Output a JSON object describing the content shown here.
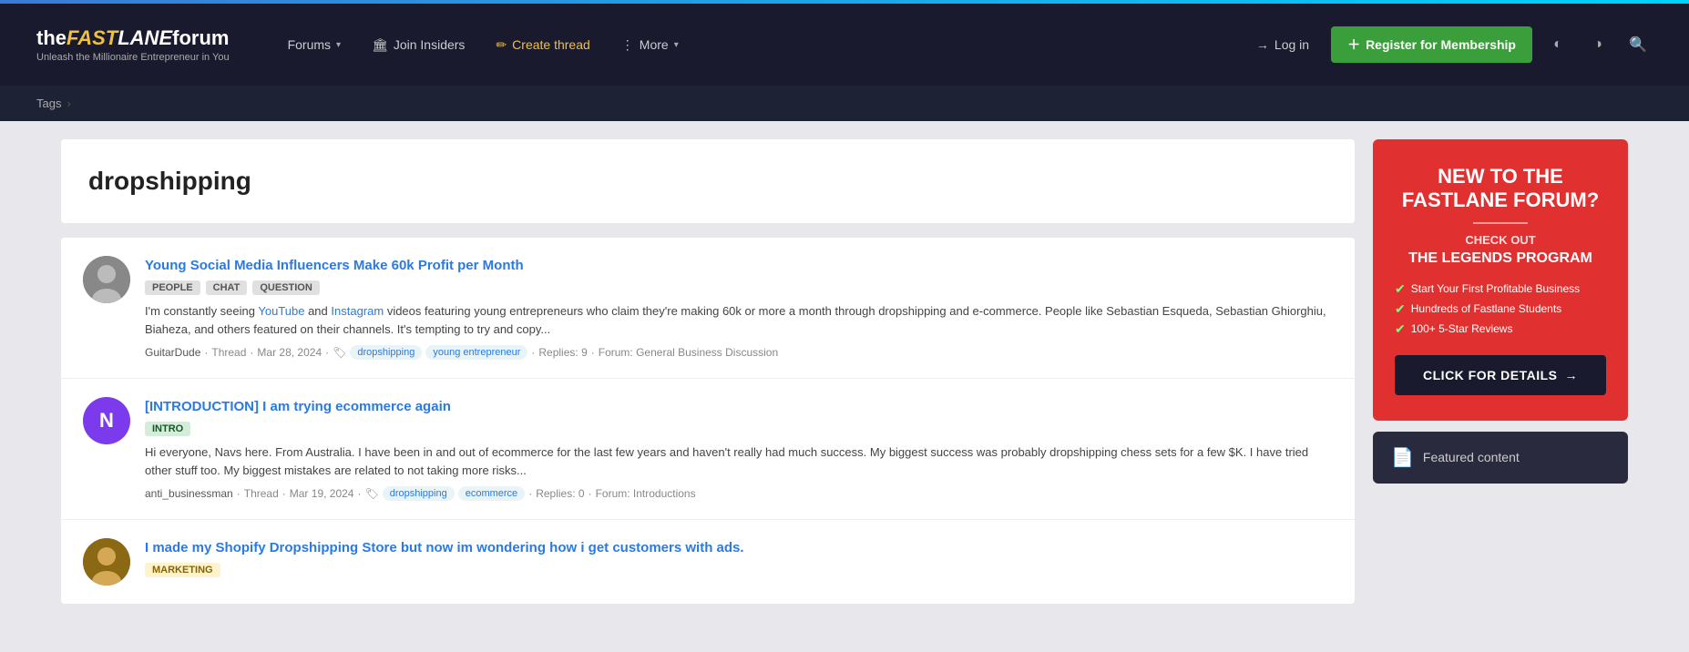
{
  "topbar": {},
  "header": {
    "logo": {
      "the": "the",
      "fast": "FAST",
      "lane": "LANE",
      "forum": "forum",
      "tagline": "Unleash the Millionaire Entrepreneur in You"
    },
    "nav": {
      "forums_label": "Forums",
      "join_insiders_label": "Join Insiders",
      "create_thread_label": "Create thread",
      "more_label": "More"
    },
    "login_label": "Log in",
    "register_label": "Register for Membership"
  },
  "breadcrumb": {
    "tags_label": "Tags"
  },
  "page": {
    "title": "dropshipping"
  },
  "threads": [
    {
      "id": 1,
      "avatar_letter": "",
      "avatar_type": "image",
      "avatar_color": "gray",
      "title": "Young Social Media Influencers Make 60k Profit per Month",
      "tags": [
        "PEOPLE",
        "CHAT",
        "QUESTION"
      ],
      "tag_types": [
        "default",
        "default",
        "default"
      ],
      "excerpt": "I'm constantly seeing YouTube and Instagram videos featuring young entrepreneurs who claim they're making 60k or more a month through dropshipping and e-commerce. People like Sebastian Esqueda, Sebastian Ghiorghiu, Biaheza, and others featured on their channels. It's tempting to try and copy...",
      "author": "GuitarDude",
      "type": "Thread",
      "date": "Mar 28, 2024",
      "tag_links": [
        "dropshipping",
        "young entrepreneur"
      ],
      "replies": "Replies: 9",
      "forum": "Forum: General Business Discussion"
    },
    {
      "id": 2,
      "avatar_letter": "N",
      "avatar_type": "letter",
      "avatar_color": "purple",
      "title": "[INTRODUCTION] I am trying ecommerce again",
      "tags": [
        "INTRO"
      ],
      "tag_types": [
        "intro"
      ],
      "excerpt": "Hi everyone, Navs here. From Australia. I have been in and out of ecommerce for the last few years and haven't really had much success. My biggest success was probably dropshipping chess sets for a few $K. I have tried other stuff too. My biggest mistakes are related to not taking more risks...",
      "author": "anti_businessman",
      "type": "Thread",
      "date": "Mar 19, 2024",
      "tag_links": [
        "dropshipping",
        "ecommerce"
      ],
      "replies": "Replies: 0",
      "forum": "Forum: Introductions"
    },
    {
      "id": 3,
      "avatar_letter": "",
      "avatar_type": "image2",
      "avatar_color": "brown",
      "title": "I made my Shopify Dropshipping Store but now im wondering how i get customers with ads.",
      "tags": [
        "MARKETING"
      ],
      "tag_types": [
        "marketing"
      ],
      "excerpt": "",
      "author": "",
      "type": "",
      "date": "",
      "tag_links": [],
      "replies": "",
      "forum": ""
    }
  ],
  "sidebar": {
    "promo": {
      "headline_1": "NEW TO THE",
      "headline_2": "FASTLANE FORUM?",
      "sub": "CHECK OUT",
      "program": "THE LEGENDS PROGRAM",
      "checklist": [
        "Start Your First Profitable Business",
        "Hundreds of Fastlane Students",
        "100+ 5-Star Reviews"
      ],
      "cta": "CLICK FOR DETAILS",
      "cta_arrow": "→"
    },
    "featured": {
      "label": "Featured content"
    }
  }
}
